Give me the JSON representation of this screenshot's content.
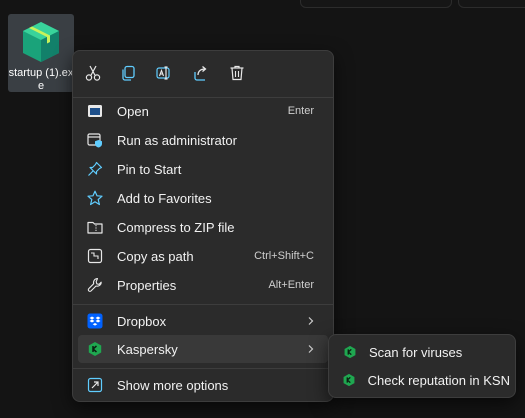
{
  "desktop": {
    "file_icon": "green-box-app-icon",
    "file_name": "startup (1).exe"
  },
  "toolbar": {
    "actions": [
      {
        "name": "Cut",
        "icon": "scissors-icon"
      },
      {
        "name": "Copy",
        "icon": "copy-icon"
      },
      {
        "name": "Rename",
        "icon": "rename-icon"
      },
      {
        "name": "Share",
        "icon": "share-icon"
      },
      {
        "name": "Delete",
        "icon": "trash-icon"
      }
    ]
  },
  "menu": {
    "items": [
      {
        "label": "Open",
        "shortcut": "Enter",
        "icon": "open-window-icon"
      },
      {
        "label": "Run as administrator",
        "shortcut": "",
        "icon": "shield-window-icon"
      },
      {
        "label": "Pin to Start",
        "shortcut": "",
        "icon": "pin-icon"
      },
      {
        "label": "Add to Favorites",
        "shortcut": "",
        "icon": "star-icon"
      },
      {
        "label": "Compress to ZIP file",
        "shortcut": "",
        "icon": "zip-folder-icon"
      },
      {
        "label": "Copy as path",
        "shortcut": "Ctrl+Shift+C",
        "icon": "copy-path-icon"
      },
      {
        "label": "Properties",
        "shortcut": "Alt+Enter",
        "icon": "wrench-icon"
      }
    ],
    "submenus": [
      {
        "label": "Dropbox",
        "icon": "dropbox-icon"
      },
      {
        "label": "Kaspersky",
        "icon": "kaspersky-icon"
      }
    ],
    "more": {
      "label": "Show more options",
      "icon": "expand-icon"
    }
  },
  "kaspersky_submenu": {
    "items": [
      {
        "label": "Scan for viruses",
        "icon": "kaspersky-icon"
      },
      {
        "label": "Check reputation in KSN",
        "icon": "kaspersky-icon"
      }
    ]
  },
  "colors": {
    "menu_bg": "#2b2b2b",
    "hover_bg": "#393939",
    "accent_blue": "#60cdff",
    "kaspersky_green": "#1fa750",
    "dropbox_blue": "#0061fe"
  }
}
